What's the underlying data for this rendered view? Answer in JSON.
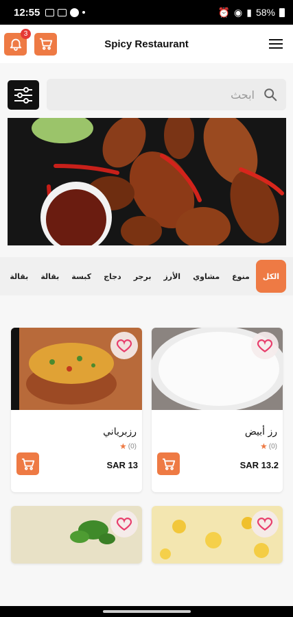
{
  "status_bar": {
    "time": "12:55",
    "battery": "58%"
  },
  "header": {
    "title": "Spicy Restaurant",
    "notification_count": "3"
  },
  "search": {
    "placeholder": "ابحث"
  },
  "categories": [
    "الكل",
    "منوع",
    "مشاوي",
    "الأرز",
    "برجر",
    "دجاج",
    "كبسة",
    "بقالة",
    "بقالة"
  ],
  "products": [
    {
      "name": "رز أبيض",
      "rating": "(0)",
      "price": "SAR 13.2"
    },
    {
      "name": "رزبرياني",
      "rating": "(0)",
      "price": "SAR 13"
    },
    {
      "name": "",
      "rating": "",
      "price": ""
    },
    {
      "name": "",
      "rating": "",
      "price": ""
    }
  ],
  "colors": {
    "accent": "#ee7a44",
    "badge": "#e53935",
    "dark": "#111111"
  },
  "icons": {
    "notifications": "bell-icon",
    "cart": "cart-icon",
    "menu": "hamburger-menu-icon",
    "filter": "sliders-icon",
    "search": "search-icon",
    "favorite": "heart-outline-icon",
    "rating": "star-icon"
  }
}
